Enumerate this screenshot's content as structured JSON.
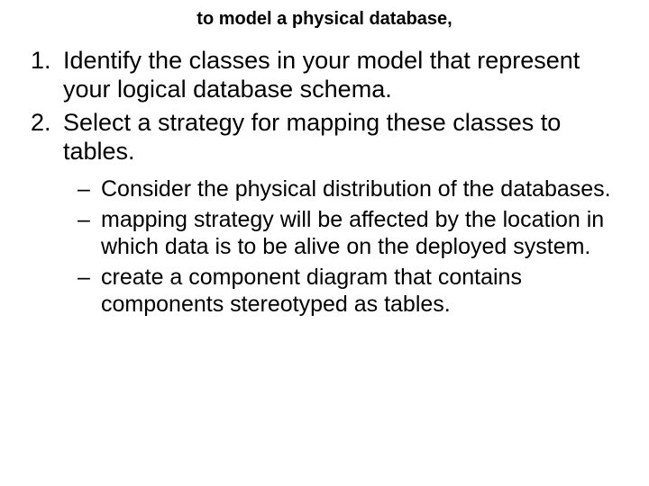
{
  "title": "to model a physical database,",
  "items": [
    "Identify the classes in your model that represent your logical database schema.",
    "Select a strategy for mapping these classes to tables."
  ],
  "subitems": [
    "Consider the physical distribution of the databases.",
    "mapping strategy will be affected by the location in which data is to be alive on the deployed system.",
    "create a component diagram that contains components stereotyped as tables."
  ]
}
